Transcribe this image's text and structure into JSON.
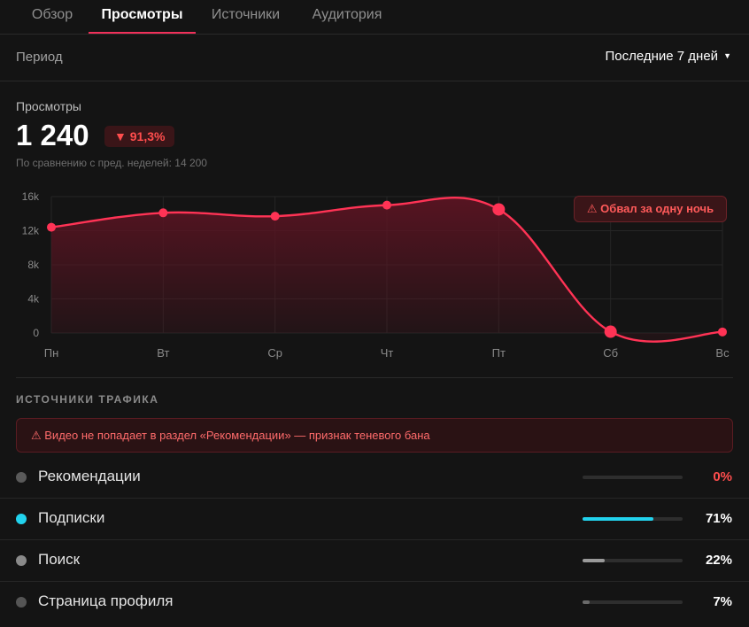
{
  "tabs": [
    {
      "label": "Обзор",
      "active": false
    },
    {
      "label": "Просмотры",
      "active": true
    },
    {
      "label": "Источники",
      "active": false
    },
    {
      "label": "Аудитория",
      "active": false
    }
  ],
  "period": {
    "label": "Период",
    "selected": "Последние 7 дней"
  },
  "metric": {
    "title": "Просмотры",
    "value": "1 240",
    "change": "▼ 91,3%",
    "comparison": "По сравнению с пред. неделей: 14 200"
  },
  "chart_alert": "⚠ Обвал за одну ночь",
  "chart_data": {
    "type": "area",
    "categories": [
      "Пн",
      "Вт",
      "Ср",
      "Чт",
      "Пт",
      "Сб",
      "Вс"
    ],
    "series": [
      {
        "values": [
          12400,
          14100,
          13700,
          15000,
          14500,
          150,
          120
        ]
      }
    ],
    "y_ticks": [
      "0",
      "4k",
      "8k",
      "12k",
      "16k"
    ],
    "ylim": [
      0,
      16000
    ],
    "grid": true,
    "colors": {
      "line": "#ff3355",
      "fill": "#5a1422"
    },
    "highlighted_points": [
      "Пт",
      "Сб"
    ]
  },
  "traffic": {
    "title": "Источники трафика",
    "warning": "⚠ Видео не попадает в раздел «Рекомендации» — признак теневого бана",
    "sources": [
      {
        "name": "Рекомендации",
        "value": "0%",
        "fraction": 0,
        "dot_color": "#5a5a5a",
        "bar_color": "#ff4d4d",
        "value_color": "#ff4d4d"
      },
      {
        "name": "Подписки",
        "value": "71%",
        "fraction": 0.71,
        "dot_color": "#22d3ee",
        "bar_color": "#22d3ee",
        "value_color": "#ffffff"
      },
      {
        "name": "Поиск",
        "value": "22%",
        "fraction": 0.22,
        "dot_color": "#8a8a8a",
        "bar_color": "#9a9a9a",
        "value_color": "#ffffff"
      },
      {
        "name": "Страница профиля",
        "value": "7%",
        "fraction": 0.07,
        "dot_color": "#555555",
        "bar_color": "#6a6a6a",
        "value_color": "#ffffff"
      }
    ]
  }
}
